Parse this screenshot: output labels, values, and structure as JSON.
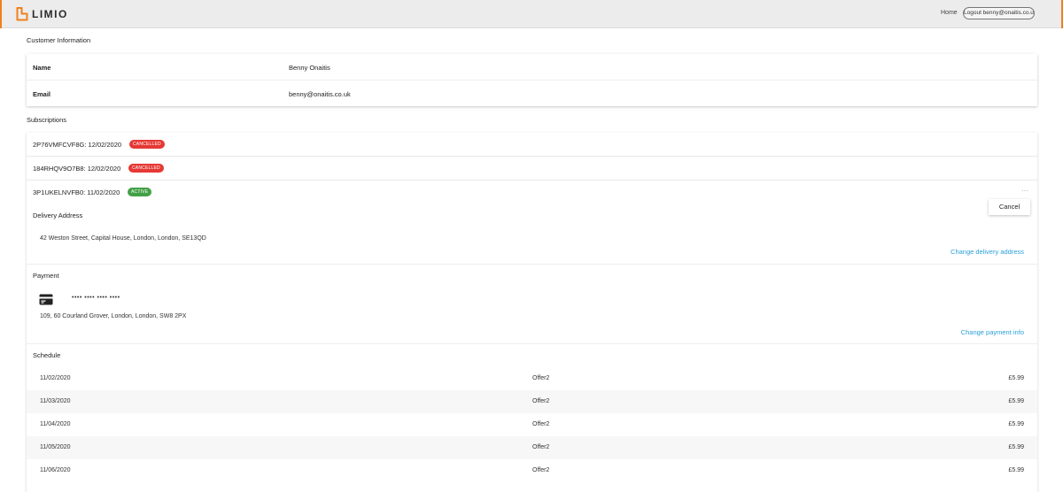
{
  "header": {
    "logo_text": "LIMIO",
    "home_label": "Home",
    "logout_label": "Logout benny@onaitis.co.uk",
    "accent_color": "#f0801e"
  },
  "customer": {
    "section_title": "Customer Information",
    "rows": [
      {
        "key": "Name",
        "value": "Benny Onaitis"
      },
      {
        "key": "Email",
        "value": "benny@onaitis.co.uk"
      }
    ]
  },
  "subscriptions": {
    "section_title": "Subscriptions",
    "items": [
      {
        "label": "2P76VMFCVF8G: 12/02/2020",
        "status": "CANCELLED",
        "status_color": "#e53935"
      },
      {
        "label": "184RHQV9O7B8: 12/02/2020",
        "status": "CANCELLED",
        "status_color": "#e53935"
      },
      {
        "label": "3P1UKELNVFB0: 11/02/2020",
        "status": "ACTIVE",
        "status_color": "#43a047"
      }
    ],
    "more_icon": "more-dots-icon",
    "cancel_label": "Cancel",
    "delivery": {
      "title": "Delivery Address",
      "address": "42 Weston Street, Capital House, London, London, SE13QD",
      "change_label": "Change delivery address"
    },
    "payment": {
      "title": "Payment",
      "card_icon": "credit-card-icon",
      "masked_number": "•••• •••• •••• ••••",
      "address": "109, 60 Courland Grover, London, London, SW8 2PX",
      "change_label": "Change payment info"
    },
    "schedule": {
      "title": "Schedule",
      "rows": [
        {
          "date": "11/02/2020",
          "offer": "Offer2",
          "price": "£5.99"
        },
        {
          "date": "11/03/2020",
          "offer": "Offer2",
          "price": "£5.99"
        },
        {
          "date": "11/04/2020",
          "offer": "Offer2",
          "price": "£5.99"
        },
        {
          "date": "11/05/2020",
          "offer": "Offer2",
          "price": "£5.99"
        },
        {
          "date": "11/06/2020",
          "offer": "Offer2",
          "price": "£5.99"
        }
      ]
    },
    "link_color": "#2aa0d8"
  }
}
